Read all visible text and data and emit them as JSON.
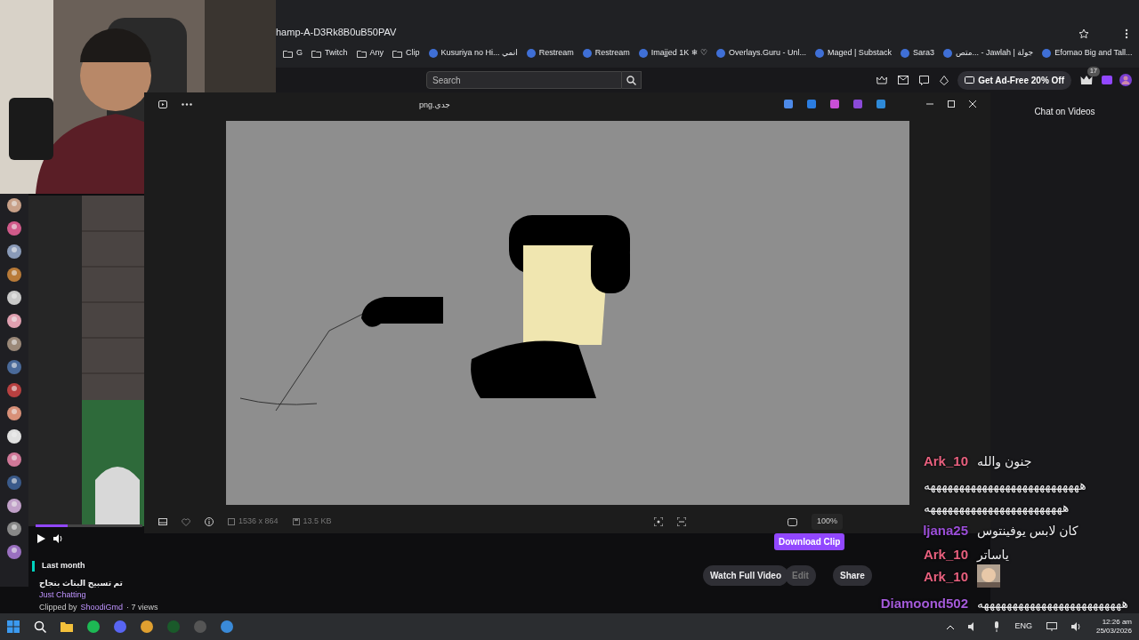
{
  "browser": {
    "address": "hamp-A-D3Rk8B0uB50PAV",
    "bookmarks": [
      {
        "label": "G",
        "kind": "folder"
      },
      {
        "label": "Twitch",
        "kind": "folder"
      },
      {
        "label": "Any",
        "kind": "folder"
      },
      {
        "label": "Clip",
        "kind": "folder"
      },
      {
        "label": "Kusuriya no Hi... انمي",
        "kind": "site"
      },
      {
        "label": "Restream",
        "kind": "site"
      },
      {
        "label": "Restream",
        "kind": "site"
      },
      {
        "label": "Imajjed 1K ❄ ♡",
        "kind": "site"
      },
      {
        "label": "Overlays.Guru - Unl...",
        "kind": "site"
      },
      {
        "label": "Maged | Substack",
        "kind": "site"
      },
      {
        "label": "Sara3",
        "kind": "site"
      },
      {
        "label": "متص... - Jawlah | جولة",
        "kind": "site"
      },
      {
        "label": "Efomao Big and Tall...",
        "kind": "site"
      }
    ]
  },
  "header": {
    "search": {
      "placeholder": "Search"
    },
    "promo": "Get Ad-Free 20% Off",
    "badge": "17"
  },
  "viewer": {
    "title": "png.جدي",
    "dimensions": "1536 x 864",
    "file_size": "13.5 KB",
    "zoom": "100%"
  },
  "chat_panel": {
    "title": "Chat on Videos"
  },
  "player": {
    "level": 0.3
  },
  "clip": {
    "date": "Last month",
    "title": "تم تسبيح البناث بنجاح",
    "category": "Just Chatting",
    "clipped_by": "Clipped by",
    "clipper": "ShoodiGmd",
    "views": "· 7 views",
    "buttons": [
      {
        "label": "Download Clip",
        "kind": "primary",
        "disabled": false
      },
      {
        "label": "Watch Full Video",
        "kind": "plain",
        "disabled": false
      },
      {
        "label": "Edit",
        "kind": "plain",
        "disabled": true
      },
      {
        "label": "Share",
        "kind": "plain",
        "disabled": false
      }
    ]
  },
  "chat": [
    {
      "kind": "text",
      "user": "Ark_10",
      "color": "#e8607e",
      "message": "جنون والله"
    },
    {
      "kind": "text",
      "message": "هههههههههههههههههههههههههههه"
    },
    {
      "kind": "text",
      "message": "ههههههههههههههههههههههههه"
    },
    {
      "kind": "text",
      "user": "ljana25",
      "color": "#9b4ed8",
      "message": "كان لابس يوفينتوس"
    },
    {
      "kind": "text",
      "user": "Ark_10",
      "color": "#e8607e",
      "message": "ياساتر"
    },
    {
      "kind": "emote",
      "user": "Ark_10",
      "color": "#e8607e"
    },
    {
      "kind": "text",
      "user": "Diamoond502",
      "color": "#a35ad8",
      "message": "هههههههههههههههههههههههههه"
    }
  ],
  "taskbar": {
    "language": "ENG",
    "time": "12:26 am",
    "date": "25/03/2026"
  }
}
